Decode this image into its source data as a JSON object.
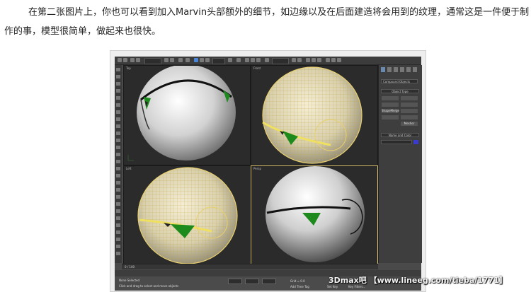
{
  "article": {
    "line1": "在第二张图片上，你也可以看到加入Marvin头部额外的细节，如边缘以及在后面建造将会用到的纹理，通常这是一件便于制",
    "line2": "作的事，模型很简单，做起来也很快。"
  },
  "app": {
    "viewports": [
      {
        "label": "Top",
        "style": "shaded"
      },
      {
        "label": "Front",
        "style": "wireframe-shaded"
      },
      {
        "label": "Left",
        "style": "wireframe-shaded"
      },
      {
        "label": "Persp",
        "style": "shaded"
      }
    ],
    "command_panel": {
      "dropdown": "Compound Objects",
      "rollout_object_type": "Object Type",
      "button_shapemerge": "ShapeMerge",
      "button_mesher": "Mesher",
      "rollout_name_color": "Name and Color"
    },
    "timeline": {
      "frame": "0 / 100"
    },
    "status": {
      "selection": "None Selected",
      "prompt": "Click and drag to select and move objects",
      "grid": "Grid = 0.0",
      "add_time_tag": "Add Time Tag",
      "set_key": "Set Key",
      "key_filters": "Key Filters..."
    },
    "colors": {
      "wire": "#d8c070",
      "background": "#2b2b2b",
      "accent_green": "#1c8a1c"
    }
  },
  "watermark": "3Dmax吧 【www.lineeg.com/tieba/1771】"
}
